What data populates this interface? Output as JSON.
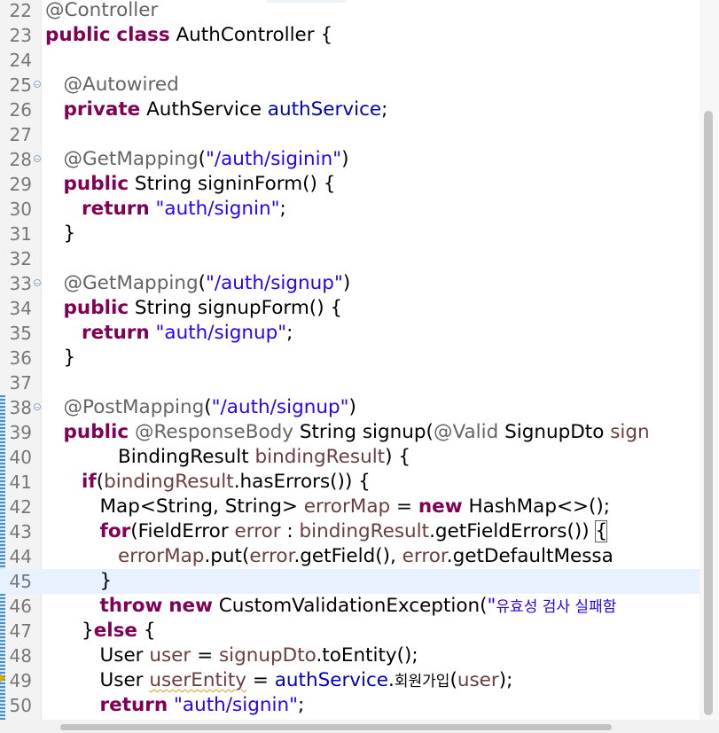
{
  "editor": {
    "current_line": "45",
    "lines": [
      {
        "num": "22",
        "fold": false,
        "tokens": [
          [
            "ann",
            "@Controller"
          ]
        ]
      },
      {
        "num": "23",
        "fold": false,
        "tokens": [
          [
            "kw",
            "public"
          ],
          [
            "",
            " "
          ],
          [
            "kw",
            "class"
          ],
          [
            "",
            " AuthController {"
          ]
        ]
      },
      {
        "num": "24",
        "fold": false,
        "tokens": []
      },
      {
        "num": "25",
        "fold": true,
        "tokens": [
          [
            "",
            "   "
          ],
          [
            "ann",
            "@Autowired"
          ]
        ]
      },
      {
        "num": "26",
        "fold": false,
        "tokens": [
          [
            "",
            "   "
          ],
          [
            "kw",
            "private"
          ],
          [
            "",
            " AuthService "
          ],
          [
            "fld",
            "authService"
          ],
          [
            "",
            ";"
          ]
        ]
      },
      {
        "num": "27",
        "fold": false,
        "tokens": []
      },
      {
        "num": "28",
        "fold": true,
        "tokens": [
          [
            "",
            "   "
          ],
          [
            "ann",
            "@GetMapping"
          ],
          [
            "",
            "("
          ],
          [
            "str",
            "\"/auth/siginin\""
          ],
          [
            "",
            ")"
          ]
        ]
      },
      {
        "num": "29",
        "fold": false,
        "tokens": [
          [
            "",
            "   "
          ],
          [
            "kw",
            "public"
          ],
          [
            "",
            " String signinForm() {"
          ]
        ]
      },
      {
        "num": "30",
        "fold": false,
        "tokens": [
          [
            "",
            "      "
          ],
          [
            "kw",
            "return"
          ],
          [
            "",
            " "
          ],
          [
            "str",
            "\"auth/signin\""
          ],
          [
            "",
            ";"
          ]
        ]
      },
      {
        "num": "31",
        "fold": false,
        "tokens": [
          [
            "",
            "   }"
          ]
        ]
      },
      {
        "num": "32",
        "fold": false,
        "tokens": []
      },
      {
        "num": "33",
        "fold": true,
        "tokens": [
          [
            "",
            "   "
          ],
          [
            "ann",
            "@GetMapping"
          ],
          [
            "",
            "("
          ],
          [
            "str",
            "\"/auth/signup\""
          ],
          [
            "",
            ")"
          ]
        ]
      },
      {
        "num": "34",
        "fold": false,
        "tokens": [
          [
            "",
            "   "
          ],
          [
            "kw",
            "public"
          ],
          [
            "",
            " String signupForm() {"
          ]
        ]
      },
      {
        "num": "35",
        "fold": false,
        "tokens": [
          [
            "",
            "      "
          ],
          [
            "kw",
            "return"
          ],
          [
            "",
            " "
          ],
          [
            "str",
            "\"auth/signup\""
          ],
          [
            "",
            ";"
          ]
        ]
      },
      {
        "num": "36",
        "fold": false,
        "tokens": [
          [
            "",
            "   }"
          ]
        ]
      },
      {
        "num": "37",
        "fold": false,
        "tokens": []
      },
      {
        "num": "38",
        "fold": true,
        "tokens": [
          [
            "",
            "   "
          ],
          [
            "ann",
            "@PostMapping"
          ],
          [
            "",
            "("
          ],
          [
            "str",
            "\"/auth/signup\""
          ],
          [
            "",
            ")"
          ]
        ]
      },
      {
        "num": "39",
        "fold": false,
        "tokens": [
          [
            "",
            "   "
          ],
          [
            "kw",
            "public"
          ],
          [
            "",
            " "
          ],
          [
            "ann",
            "@ResponseBody"
          ],
          [
            "",
            " String signup("
          ],
          [
            "ann",
            "@Valid"
          ],
          [
            "",
            " SignupDto "
          ],
          [
            "var",
            "sign"
          ]
        ]
      },
      {
        "num": "40",
        "fold": false,
        "tokens": [
          [
            "",
            "            BindingResult "
          ],
          [
            "var",
            "bindingResult"
          ],
          [
            "",
            ") {"
          ]
        ]
      },
      {
        "num": "41",
        "fold": false,
        "tokens": [
          [
            "",
            "      "
          ],
          [
            "kw",
            "if"
          ],
          [
            "",
            "("
          ],
          [
            "var",
            "bindingResult"
          ],
          [
            "",
            ".hasErrors()) {"
          ]
        ]
      },
      {
        "num": "42",
        "fold": false,
        "tokens": [
          [
            "",
            "         Map<String, String> "
          ],
          [
            "var",
            "errorMap"
          ],
          [
            "",
            " = "
          ],
          [
            "kw",
            "new"
          ],
          [
            "",
            " HashMap<>();"
          ]
        ]
      },
      {
        "num": "43",
        "fold": false,
        "tokens": [
          [
            "",
            "         "
          ],
          [
            "kw",
            "for"
          ],
          [
            "",
            "(FieldError "
          ],
          [
            "var",
            "error"
          ],
          [
            "",
            " : "
          ],
          [
            "var",
            "bindingResult"
          ],
          [
            "",
            ".getFieldErrors()) "
          ],
          [
            "box",
            "{"
          ]
        ]
      },
      {
        "num": "44",
        "fold": false,
        "tokens": [
          [
            "",
            "            "
          ],
          [
            "var",
            "errorMap"
          ],
          [
            "",
            ".put("
          ],
          [
            "var",
            "error"
          ],
          [
            "",
            ".getField(), "
          ],
          [
            "var",
            "error"
          ],
          [
            "",
            ".getDefaultMessa"
          ]
        ]
      },
      {
        "num": "45",
        "fold": false,
        "tokens": [
          [
            "",
            "         }"
          ]
        ]
      },
      {
        "num": "46",
        "fold": false,
        "tokens": [
          [
            "",
            "         "
          ],
          [
            "kw",
            "throw"
          ],
          [
            "",
            " "
          ],
          [
            "kw",
            "new"
          ],
          [
            "",
            " CustomValidationException("
          ],
          [
            "str",
            "\""
          ],
          [
            "kostr",
            "유효성 검사 실패함"
          ]
        ]
      },
      {
        "num": "47",
        "fold": false,
        "tokens": [
          [
            "",
            "      }"
          ],
          [
            "kw",
            "else"
          ],
          [
            "",
            " {"
          ]
        ]
      },
      {
        "num": "48",
        "fold": false,
        "tokens": [
          [
            "",
            "         User "
          ],
          [
            "var",
            "user"
          ],
          [
            "",
            " = "
          ],
          [
            "var",
            "signupDto"
          ],
          [
            "",
            ".toEntity();"
          ]
        ]
      },
      {
        "num": "49",
        "fold": false,
        "tokens": [
          [
            "",
            "         User "
          ],
          [
            "warnvar",
            "userEntity"
          ],
          [
            "",
            " = "
          ],
          [
            "fld",
            "authService"
          ],
          [
            "",
            "."
          ],
          [
            "ko",
            "회원가입"
          ],
          [
            "",
            "("
          ],
          [
            "var",
            "user"
          ],
          [
            "",
            ");"
          ]
        ]
      },
      {
        "num": "50",
        "fold": false,
        "tokens": [
          [
            "",
            "         "
          ],
          [
            "kw",
            "return"
          ],
          [
            "",
            " "
          ],
          [
            "str",
            "\"auth/signin\""
          ],
          [
            "",
            ";"
          ]
        ]
      }
    ]
  },
  "colors": {
    "keyword": "#7f0055",
    "annotation": "#646464",
    "string": "#2a00ff",
    "local_variable": "#6a3e3e",
    "field": "#0000c0",
    "current_line_bg": "#e8f2fe"
  },
  "icons": {
    "fold_marker": "collapse-fold-icon",
    "warning_marker": "warning-marker-icon"
  }
}
